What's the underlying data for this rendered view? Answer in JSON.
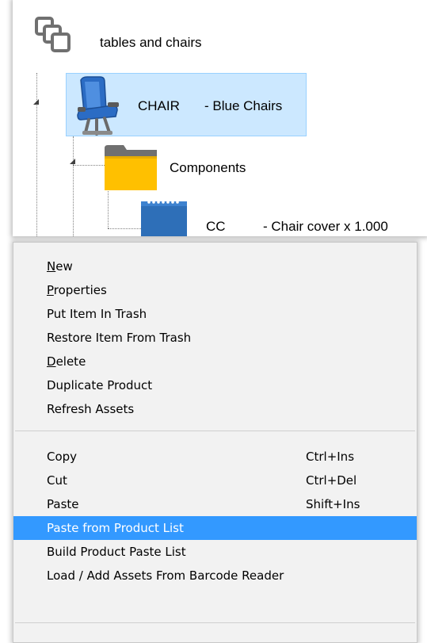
{
  "tree": {
    "root": {
      "label": "tables and chairs",
      "icon": "group-icon"
    },
    "chair": {
      "code": "CHAIR",
      "desc": "- Blue Chairs",
      "icon": "blue-chair-icon"
    },
    "components": {
      "label": "Components",
      "icon": "folder-icon"
    },
    "cc": {
      "code": "CC",
      "desc": "- Chair cover x 1.000",
      "icon": "notepad-icon"
    }
  },
  "menu": {
    "group1": [
      {
        "label": "New",
        "hotkey_index": 0
      },
      {
        "label": "Properties",
        "hotkey_index": 0
      },
      {
        "label": "Put Item In Trash"
      },
      {
        "label": "Restore Item From Trash"
      },
      {
        "label": "Delete",
        "hotkey_index": 0
      },
      {
        "label": "Duplicate Product"
      },
      {
        "label": "Refresh Assets"
      }
    ],
    "group2": [
      {
        "label": "Copy",
        "shortcut": "Ctrl+Ins"
      },
      {
        "label": "Cut",
        "shortcut": "Ctrl+Del"
      },
      {
        "label": "Paste",
        "shortcut": "Shift+Ins"
      },
      {
        "label": "Paste from Product List",
        "highlighted": true
      },
      {
        "label": "Build Product Paste List"
      },
      {
        "label": "Load / Add Assets From Barcode Reader"
      }
    ]
  },
  "colors": {
    "selection_bg": "#cce8ff",
    "selection_border": "#99d1ff",
    "menu_highlight": "#3399ff",
    "folder_yellow": "#ffc000",
    "chair_blue": "#2b6cc4"
  }
}
